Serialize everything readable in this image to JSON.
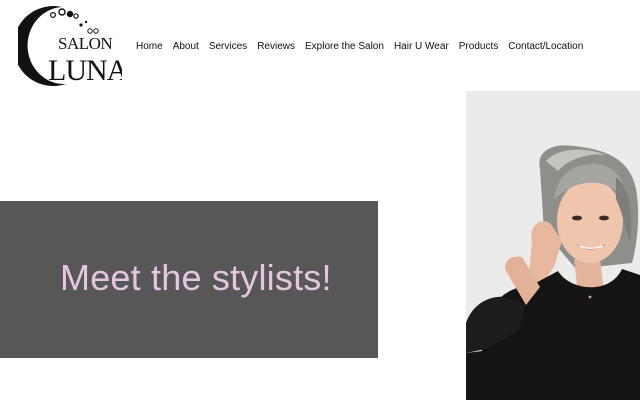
{
  "logo": {
    "alt": "Salon Luna logo",
    "line1": "SALON",
    "line2": "LUNA"
  },
  "nav": {
    "items": [
      {
        "label": "Home"
      },
      {
        "label": "About"
      },
      {
        "label": "Services"
      },
      {
        "label": "Reviews"
      },
      {
        "label": "Explore the Salon"
      },
      {
        "label": "Hair U Wear"
      },
      {
        "label": "Products"
      },
      {
        "label": "Contact/Location"
      }
    ]
  },
  "hero": {
    "heading": "Meet the stylists!",
    "banner_color": "#575757",
    "heading_color": "#e4c6de"
  },
  "photo": {
    "alt": "Stylist portrait"
  }
}
